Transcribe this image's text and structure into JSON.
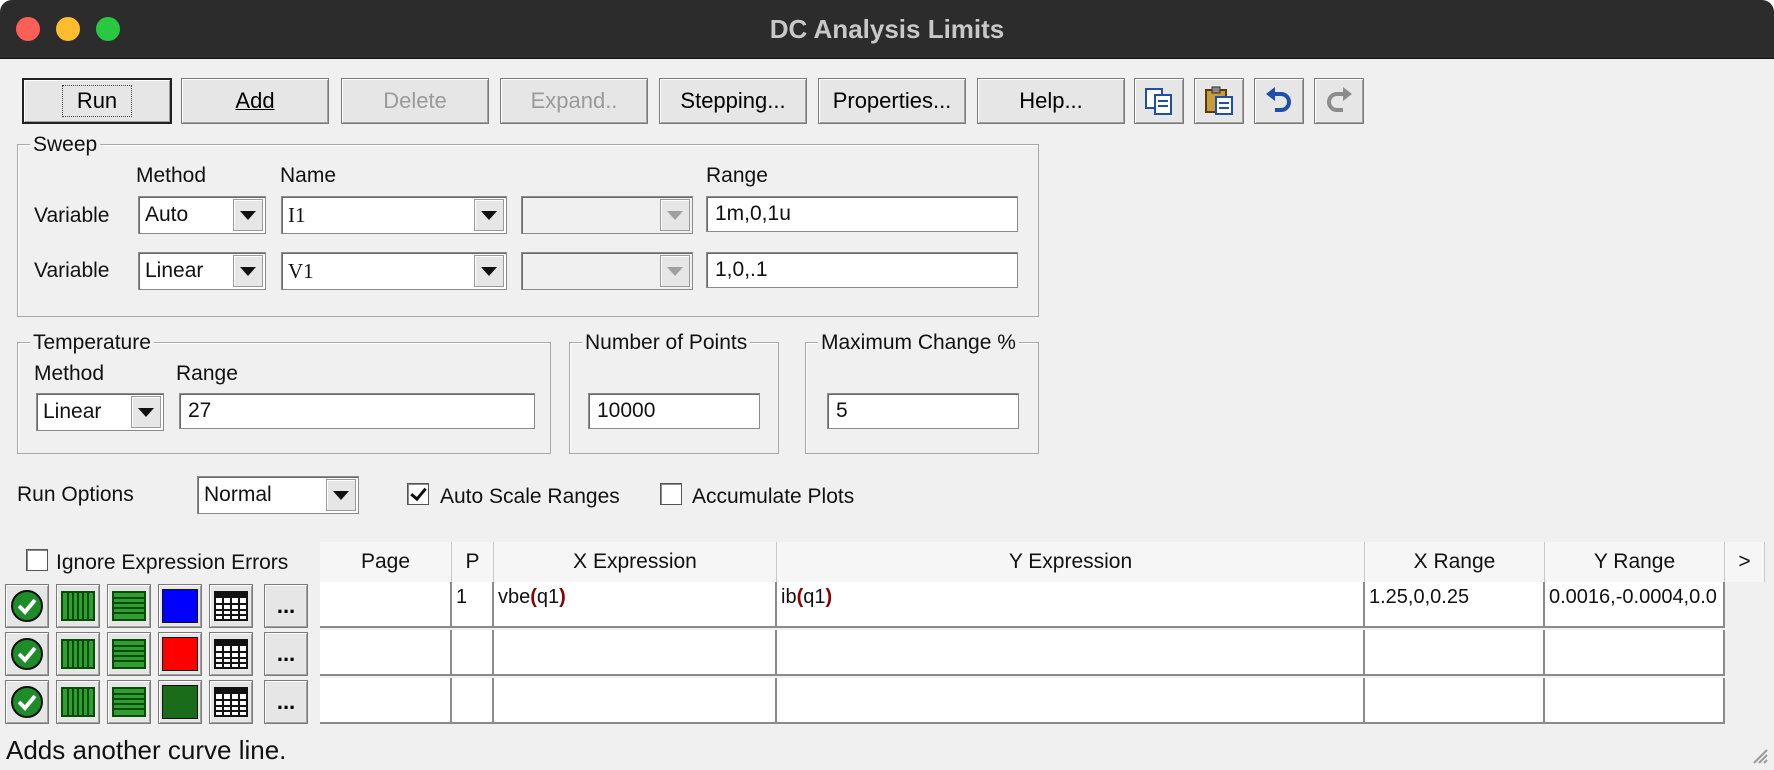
{
  "window": {
    "title": "DC Analysis Limits"
  },
  "toolbar": {
    "run": "Run",
    "add": "Add",
    "delete": "Delete",
    "expand": "Expand..",
    "stepping": "Stepping...",
    "properties": "Properties...",
    "help": "Help...",
    "icons": [
      "copy-icon",
      "paste-icon",
      "undo-icon",
      "redo-icon"
    ]
  },
  "sweep": {
    "legend": "Sweep",
    "col_method": "Method",
    "col_name": "Name",
    "col_range": "Range",
    "rows": [
      {
        "label": "Variable",
        "method": "Auto",
        "name": "I1",
        "range": "1m,0,1u"
      },
      {
        "label": "Variable",
        "method": "Linear",
        "name": "V1",
        "range": "1,0,.1"
      }
    ]
  },
  "temperature": {
    "legend": "Temperature",
    "col_method": "Method",
    "col_range": "Range",
    "method": "Linear",
    "range": "27"
  },
  "points": {
    "legend": "Number of Points",
    "value": "10000"
  },
  "maxchange": {
    "legend": "Maximum Change %",
    "value": "5"
  },
  "run_options": {
    "label": "Run Options",
    "value": "Normal",
    "auto_scale": {
      "label": "Auto Scale Ranges",
      "checked": true
    },
    "accumulate": {
      "label": "Accumulate Plots",
      "checked": false
    }
  },
  "ignore_errors": {
    "label": "Ignore Expression Errors",
    "checked": false
  },
  "grid": {
    "headers": {
      "page": "Page",
      "p": "P",
      "x_expr": "X Expression",
      "y_expr": "Y Expression",
      "x_range": "X Range",
      "y_range": "Y Range",
      "more": ">"
    },
    "rows": [
      {
        "color": "#0000ff",
        "page": "",
        "p": "1",
        "x_func": "vbe",
        "x_arg": "q1",
        "y_func": "ib",
        "y_arg": "q1",
        "x_range": "1.25,0,0.25",
        "y_range": "0.0016,-0.0004,0.0"
      },
      {
        "color": "#ff0000",
        "page": "",
        "p": "",
        "x_func": "",
        "x_arg": "",
        "y_func": "",
        "y_arg": "",
        "x_range": "",
        "y_range": ""
      },
      {
        "color": "#1a6b1a",
        "page": "",
        "p": "",
        "x_func": "",
        "x_arg": "",
        "y_func": "",
        "y_arg": "",
        "x_range": "",
        "y_range": ""
      }
    ],
    "row_more": "..."
  },
  "status": "Adds another curve line."
}
